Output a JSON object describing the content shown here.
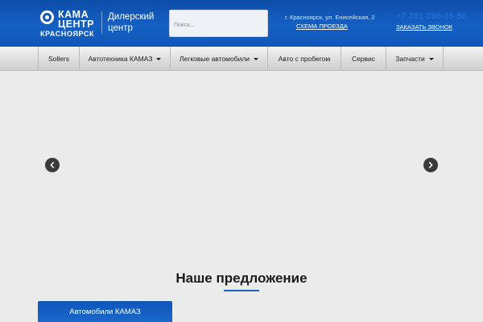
{
  "header": {
    "logo": {
      "line1": "КАМА",
      "line2": "ЦЕНТР",
      "line3": "КРАСНОЯРСК"
    },
    "dealer_label": "Дилерский центр",
    "search": {
      "placeholder": "Поиск..."
    },
    "address": "г. Красноярск, ул. Енисейская, 2",
    "map_link": "СХЕМА ПРОЕЗДА",
    "phone": "+7 391 290-25-50",
    "callback_link": "ЗАКАЗАТЬ ЗВОНОК"
  },
  "nav": {
    "items": [
      {
        "label": "Sollers",
        "has_dropdown": false
      },
      {
        "label": "Автотехника КАМАЗ",
        "has_dropdown": true
      },
      {
        "label": "Легковые автомобили",
        "has_dropdown": true
      },
      {
        "label": "Авто с пробегом",
        "has_dropdown": false
      },
      {
        "label": "Сервис",
        "has_dropdown": false
      },
      {
        "label": "Запчасти",
        "has_dropdown": true
      }
    ]
  },
  "slider": {
    "icons": {
      "prev": "chevron-left-icon",
      "next": "chevron-right-icon"
    }
  },
  "offer": {
    "title": "Наше предложение",
    "cards": [
      {
        "label": "Автомобили КАМАЗ"
      }
    ]
  },
  "colors": {
    "header_blue": "#1560c4",
    "phone_blue": "#2a7be0",
    "accent_blue": "#1d63c6",
    "page_bg": "#ebebeb"
  }
}
